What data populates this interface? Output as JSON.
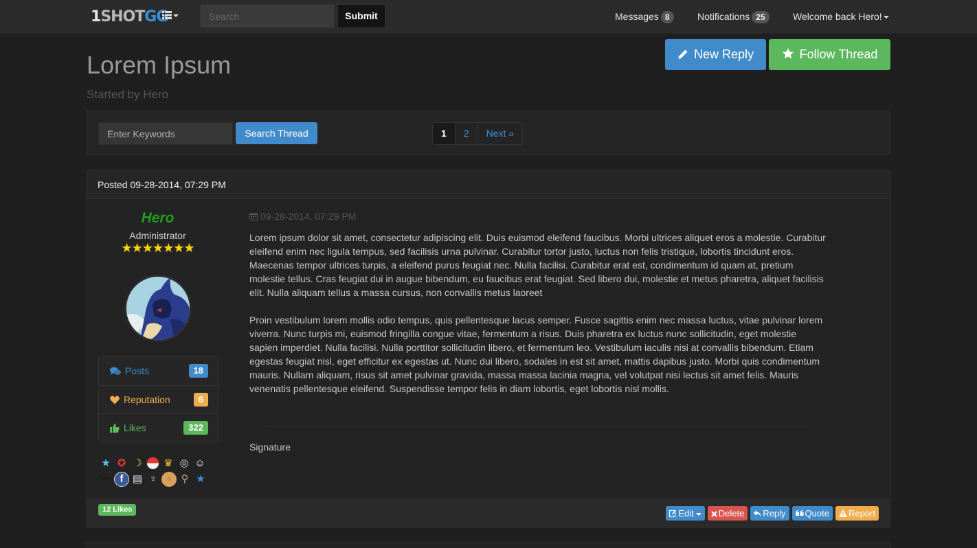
{
  "brand": {
    "part1": "1",
    "part2": "SHOT",
    "part3": "GG"
  },
  "navbar": {
    "search_placeholder": "Search",
    "submit_label": "Submit",
    "messages_label": "Messages",
    "messages_count": "8",
    "notifications_label": "Notifications",
    "notifications_count": "25",
    "welcome_label": "Welcome back Hero!"
  },
  "thread": {
    "title": "Lorem Ipsum",
    "subtitle": "Started by Hero",
    "new_reply_label": "New Reply",
    "follow_label": "Follow Thread"
  },
  "thread_search": {
    "placeholder": "Enter Keywords",
    "button_label": "Search Thread"
  },
  "pagination": {
    "pages": [
      "1",
      "2"
    ],
    "active": "1",
    "next_label": "Next »"
  },
  "post": {
    "header": "Posted 09-28-2014, 07:29 PM",
    "date": "09-28-2014, 07:29 PM",
    "paragraphs": [
      "Lorem ipsum dolor sit amet, consectetur adipiscing elit. Duis euismod eleifend faucibus. Morbi ultrices aliquet eros a molestie. Curabitur eleifend enim nec ligula tempus, sed facilisis urna pulvinar. Curabitur tortor justo, luctus non felis tristique, lobortis tincidunt eros. Maecenas tempor ultrices turpis, a eleifend purus feugiat nec. Nulla facilisi. Curabitur erat est, condimentum id quam at, pretium molestie tellus. Cras feugiat dui in augue bibendum, eu faucibus erat feugiat. Sed libero dui, molestie et metus pharetra, aliquet facilisis elit. Nulla aliquam tellus a massa cursus, non convallis metus laoreet",
      "Proin vestibulum lorem mollis odio tempus, quis pellentesque lacus semper. Fusce sagittis enim nec massa luctus, vitae pulvinar lorem viverra. Nunc turpis mi, euismod fringilla congue vitae, fermentum a risus. Duis pharetra ex luctus nunc sollicitudin, eget molestie sapien imperdiet. Nulla facilisi. Nulla porttitor sollicitudin libero, et fermentum leo. Vestibulum iaculis nisi at convallis bibendum. Etiam egestas feugiat nisl, eget efficitur ex egestas ut. Nunc dui libero, sodales in est sit amet, mattis dapibus justo. Morbi quis condimentum mauris. Nullam aliquam, risus sit amet pulvinar gravida, massa massa lacinia magna, vel volutpat nisi lectus sit amet felis. Mauris venenatis pellentesque eleifend. Suspendisse tempor felis in diam lobortis, eget lobortis nisl mollis."
    ],
    "signature": "Signature",
    "likes_badge": "12 Likes"
  },
  "author": {
    "name": "Hero",
    "role": "Administrator",
    "stars": "★★★★★★★",
    "name_color": "#1e9e1e"
  },
  "author_stats": [
    {
      "label": "Posts",
      "count": "18",
      "color": "#428bca",
      "icon": "comments-icon"
    },
    {
      "label": "Reputation",
      "count": "6",
      "color": "#f0ad4e",
      "icon": "heart-icon"
    },
    {
      "label": "Likes",
      "count": "322",
      "color": "#5cb85c",
      "icon": "thumbs-up-icon"
    }
  ],
  "awards": [
    [
      "star-icon",
      "red-star-icon",
      "banana-icon",
      "pokeball-icon",
      "crown-icon",
      "gamepad-icon",
      "cat-icon"
    ],
    [
      "mustache-icon",
      "facebook-icon",
      "document-icon",
      "microphone-icon",
      "cookie-icon",
      "spoon-icon",
      "blue-star-icon"
    ]
  ],
  "post_actions": [
    {
      "label": "Edit",
      "color": "#428bca",
      "icon": "edit-icon"
    },
    {
      "label": "Delete",
      "color": "#d9534f",
      "icon": "times-icon"
    },
    {
      "label": "Reply",
      "color": "#428bca",
      "icon": "reply-icon"
    },
    {
      "label": "Quote",
      "color": "#428bca",
      "icon": "quote-icon"
    },
    {
      "label": "Report",
      "color": "#f0ad4e",
      "icon": "warning-icon"
    }
  ],
  "colors": {
    "primary": "#428bca",
    "success": "#5cb85c",
    "warning": "#f0ad4e",
    "danger": "#d9534f",
    "background": "#1f1f1f"
  }
}
